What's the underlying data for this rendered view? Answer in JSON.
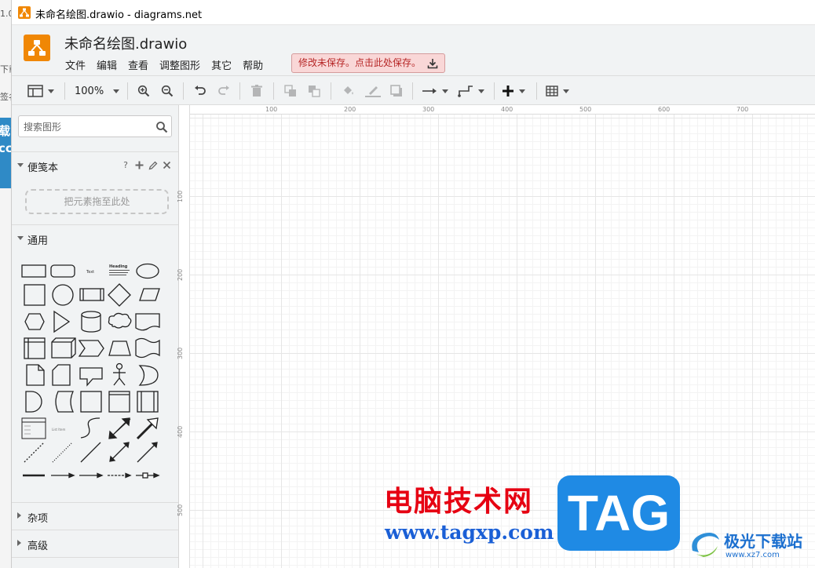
{
  "window": {
    "title": "未命名绘图.drawio - diagrams.net"
  },
  "background_window": {
    "snippets": [
      "1.0",
      "下载",
      "签名",
      "载",
      "cc"
    ]
  },
  "header": {
    "doc_title": "未命名绘图.drawio",
    "menus": [
      "文件",
      "编辑",
      "查看",
      "调整图形",
      "其它",
      "帮助"
    ],
    "save_notice": "修改未保存。点击此处保存。"
  },
  "toolbar": {
    "zoom": "100%"
  },
  "sidebar": {
    "search_placeholder": "搜索图形",
    "scratchpad": {
      "title": "便笺本",
      "help": "?",
      "drop_hint": "把元素拖至此处"
    },
    "general": {
      "title": "通用",
      "text_shape": "Text",
      "heading_shape": "Heading",
      "list_item_shape": "List Item"
    },
    "misc": {
      "title": "杂项"
    },
    "advanced": {
      "title": "高级"
    }
  },
  "canvas": {
    "ruler_h": [
      "100",
      "200",
      "300",
      "400",
      "500",
      "600",
      "700"
    ],
    "ruler_v": [
      "100",
      "200",
      "300",
      "400",
      "500"
    ]
  },
  "watermark": {
    "site_cn": "电脑技术网",
    "site_url": "www.tagxp.com",
    "tag": "TAG",
    "brand": "极光下载站",
    "brand_url": "www.xz7.com"
  }
}
